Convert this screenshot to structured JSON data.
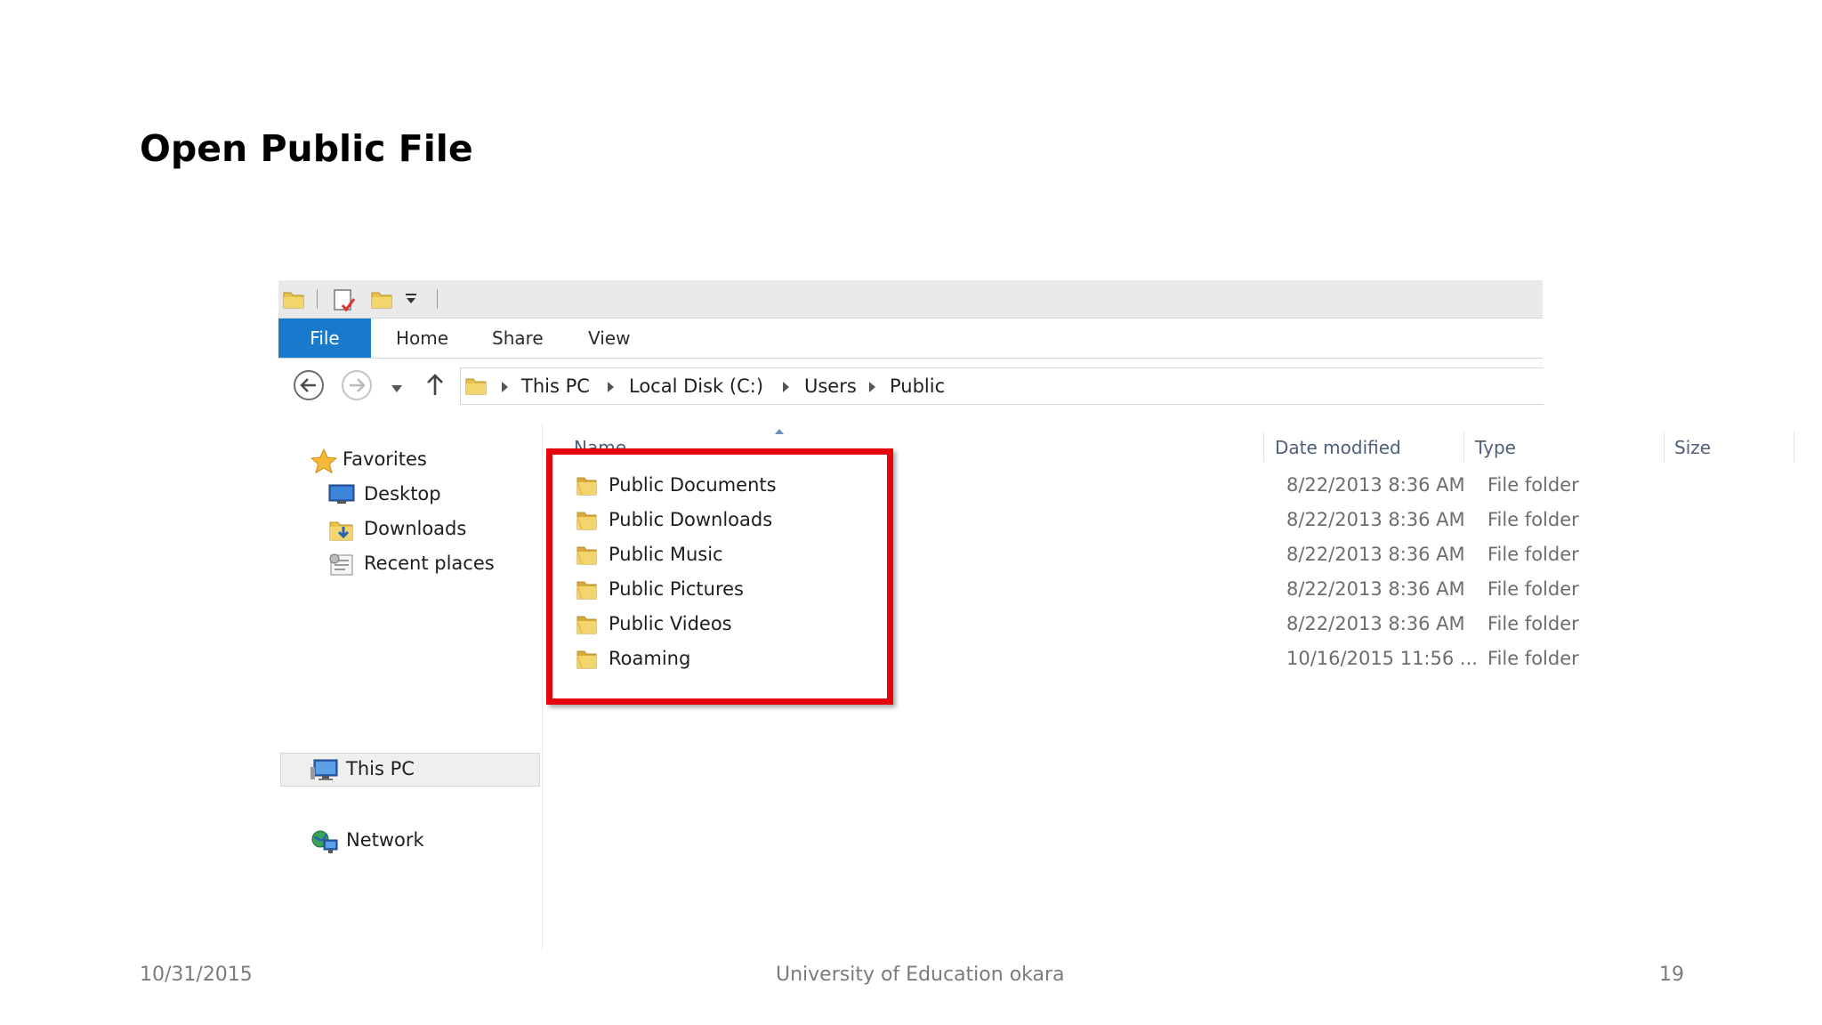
{
  "slide": {
    "title": "Open Public File",
    "footer_date": "10/31/2015",
    "footer_center": "University of Education okara",
    "footer_page": "19"
  },
  "ribbon": {
    "tabs": [
      "File",
      "Home",
      "Share",
      "View"
    ]
  },
  "address": {
    "crumbs": [
      "This PC",
      "Local Disk (C:)",
      "Users",
      "Public"
    ]
  },
  "nav": {
    "favorites": "Favorites",
    "desktop": "Desktop",
    "downloads": "Downloads",
    "recent": "Recent places",
    "this_pc": "This PC",
    "network": "Network"
  },
  "columns": {
    "name": "Name",
    "date": "Date modified",
    "type": "Type",
    "size": "Size"
  },
  "files": [
    {
      "name": "Public Documents",
      "date": "8/22/2013 8:36 AM",
      "type": "File folder"
    },
    {
      "name": "Public Downloads",
      "date": "8/22/2013 8:36 AM",
      "type": "File folder"
    },
    {
      "name": "Public Music",
      "date": "8/22/2013 8:36 AM",
      "type": "File folder"
    },
    {
      "name": "Public Pictures",
      "date": "8/22/2013 8:36 AM",
      "type": "File folder"
    },
    {
      "name": "Public Videos",
      "date": "8/22/2013 8:36 AM",
      "type": "File folder"
    },
    {
      "name": "Roaming",
      "date": "10/16/2015 11:56 ...",
      "type": "File folder"
    }
  ],
  "colors": {
    "file_tab": "#1979ca",
    "highlight": "#e3070d",
    "folder": "#e8c04a"
  }
}
